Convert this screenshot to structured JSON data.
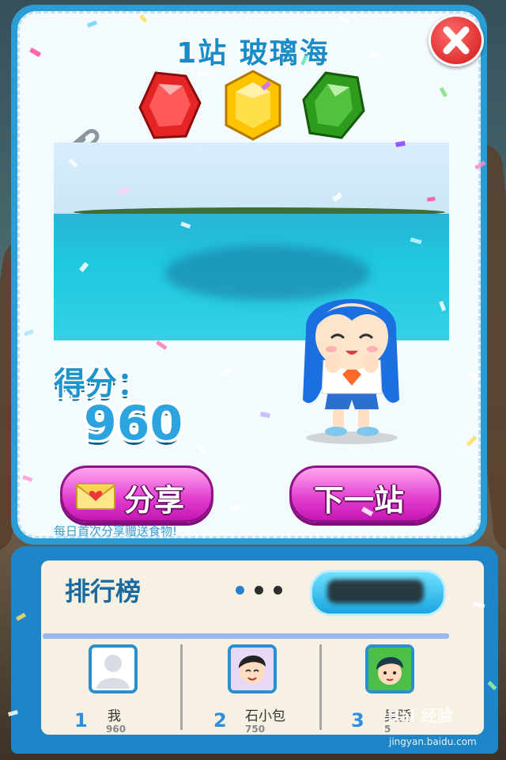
{
  "level": {
    "title": "1站 玻璃海"
  },
  "gems": [
    {
      "name": "red-gem-icon",
      "color": "#e52525"
    },
    {
      "name": "yellow-gem-icon",
      "color": "#ffc400"
    },
    {
      "name": "green-gem-icon",
      "color": "#2e9a1e"
    }
  ],
  "score": {
    "label": "得分：",
    "value": "960"
  },
  "buttons": {
    "share": "分享",
    "next": "下一站"
  },
  "hint": "每日首次分享赠送食物!",
  "leaderboard": {
    "title": "排行榜",
    "players": [
      {
        "rank": "1",
        "name": "我",
        "score": "960"
      },
      {
        "rank": "2",
        "name": "石小包",
        "score": "750"
      },
      {
        "rank": "3",
        "name": "吴骄",
        "score": "5"
      }
    ]
  },
  "watermark": {
    "logo": "Bai 经验",
    "url": "jingyan.baidu.com"
  }
}
